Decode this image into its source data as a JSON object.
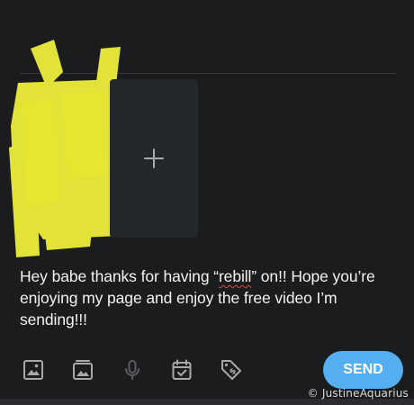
{
  "composer": {
    "message_text_before": "Hey babe thanks for having “",
    "message_misspelled_word": "rebill",
    "message_text_after": "” on!! Hope you’re enjoying my page and enjoy the free video I’m sending!!!",
    "add_media_icon": "plus-icon"
  },
  "toolbar": {
    "icons": [
      "image-icon",
      "gallery-icon",
      "microphone-icon",
      "calendar-check-icon",
      "price-tag-icon"
    ],
    "send_label": "SEND"
  },
  "watermark": {
    "text": "©  JustineAquarius"
  },
  "colors": {
    "background": "#1b1c1e",
    "send_button": "#54aef0",
    "icon_default": "#a6a8ab",
    "icon_disabled": "#5a5d61",
    "redaction": "#f2f13a"
  }
}
